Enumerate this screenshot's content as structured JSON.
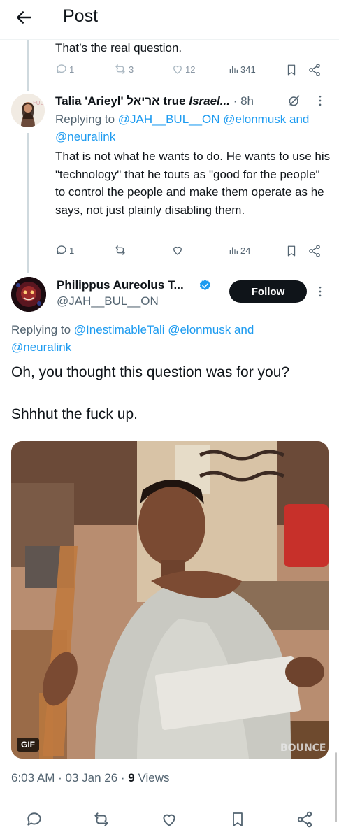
{
  "header": {
    "title": "Post"
  },
  "tweet_prev": {
    "text": "That’s the real question.",
    "replies": "1",
    "retweets": "3",
    "likes": "12",
    "views": "341"
  },
  "tweet_reply": {
    "display_name": "Talia 'Arieyl' אריאל true",
    "display_name_italic": "Israel...",
    "time": "· 8h",
    "replying_prefix": "Replying to",
    "replying_mentions": "@JAH__BUL__ON @elonmusk and",
    "replying_mentions2": "@neuralink",
    "text": "That is not what he wants to do. He wants to use his \"technology\" that he touts as \"good for the people\" to control the people and make them operate as he says, not just plainly disabling them.",
    "replies": "1",
    "retweets": "",
    "likes": "",
    "views": "24"
  },
  "main_tweet": {
    "display_name": "Philippus Aureolus T...",
    "handle": "@JAH__BUL__ON",
    "follow_label": "Follow",
    "replying_prefix": "Replying to",
    "replying_mentions": "@InestimableTali @elonmusk and",
    "replying_mentions2": "@neuralink",
    "line1": "Oh, you thought this question was for you?",
    "line2": "Shhhut the fuck up.",
    "gif_badge": "GIF",
    "timestamp": "6:03 AM · 03 Jan 26 ·",
    "views_count": "9",
    "views_label": "Views"
  },
  "colors": {
    "accent": "#1d9bf0",
    "text": "#0f1419",
    "muted": "#536471",
    "follow_bg": "#0f1419"
  },
  "icons": [
    "back-arrow-icon",
    "reply-icon",
    "retweet-icon",
    "like-icon",
    "views-icon",
    "bookmark-icon",
    "share-icon",
    "verified-icon",
    "grok-icon",
    "more-icon"
  ]
}
